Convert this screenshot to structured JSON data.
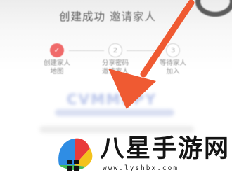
{
  "dialog": {
    "title_main": "创建成功",
    "title_accent": "邀请家人"
  },
  "steps": [
    {
      "number": "✓",
      "label_line1": "创建家人",
      "label_line2": "地图",
      "state": "done"
    },
    {
      "number": "2",
      "label_line1": "分享密码",
      "label_line2": "邀请家人",
      "state": "todo"
    },
    {
      "number": "3",
      "label_line1": "等待家人",
      "label_line2": "加入",
      "state": "todo"
    }
  ],
  "invite": {
    "code": "CVMMBPY"
  },
  "annotation": {
    "arrow_color": "#ef5a32"
  },
  "watermark": {
    "site_name": "八星手游网",
    "url": "www.lyshbx.com"
  }
}
